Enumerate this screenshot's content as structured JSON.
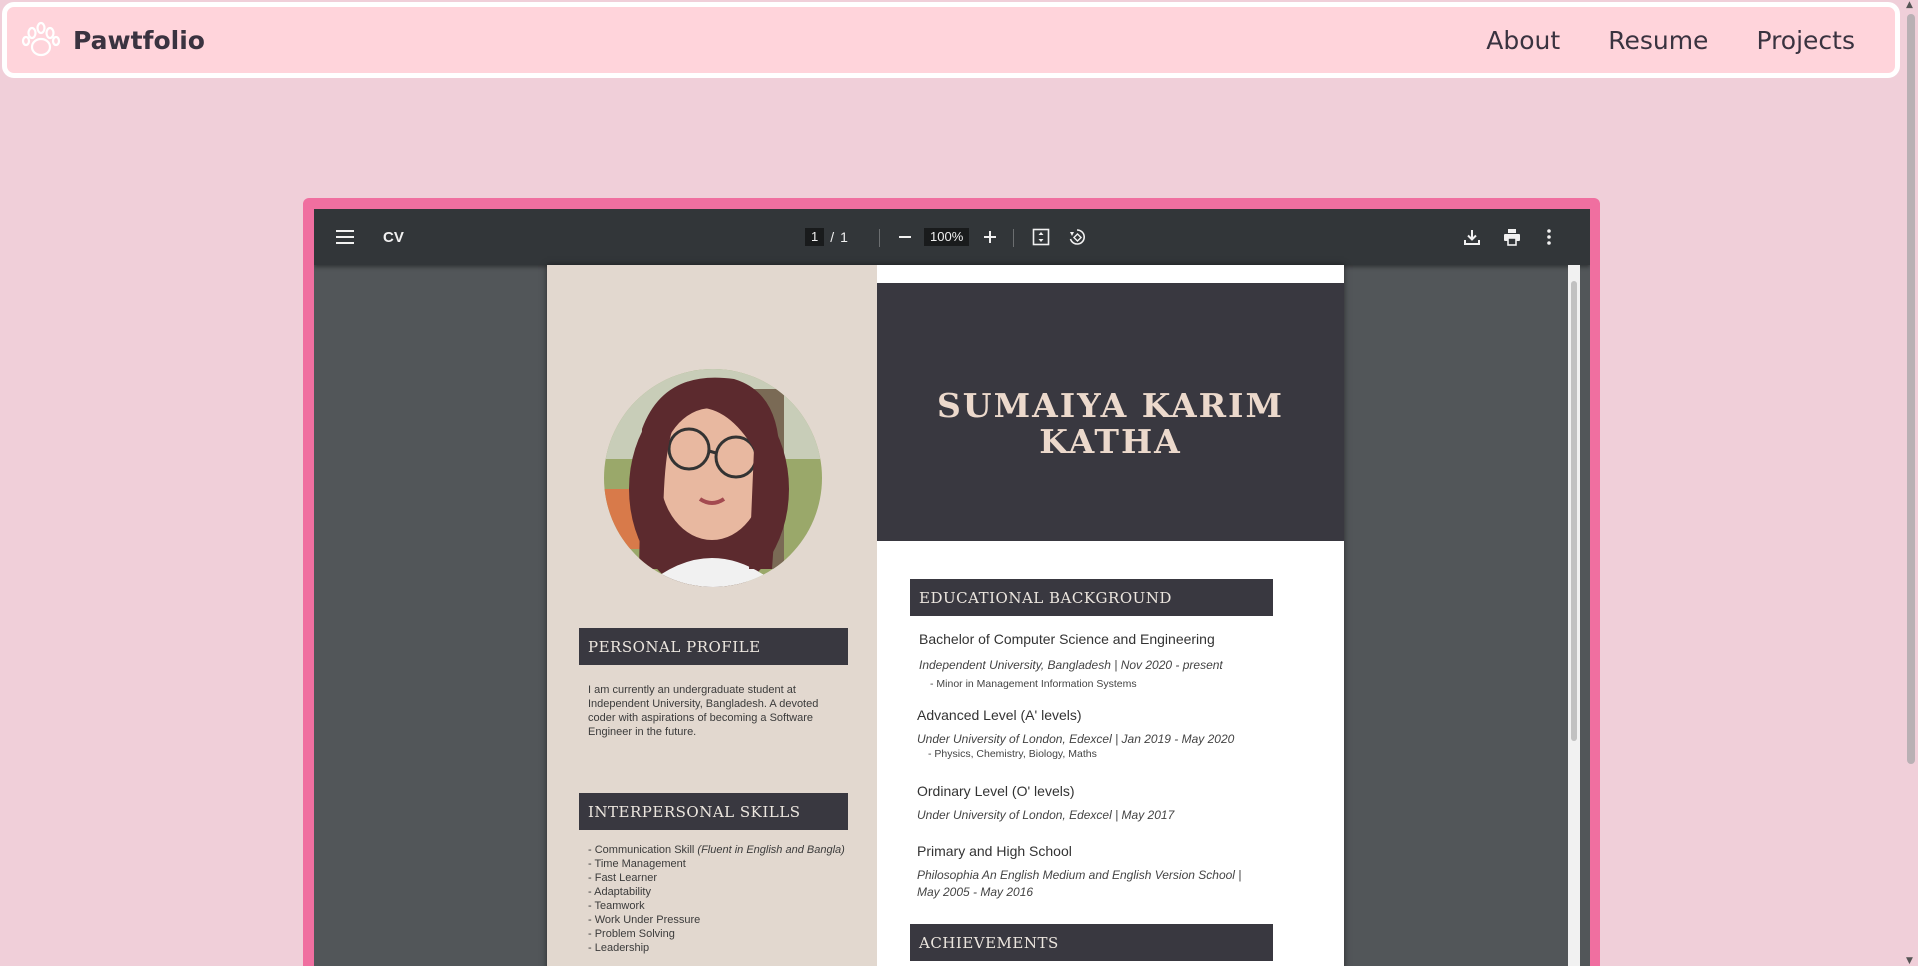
{
  "nav": {
    "brand": "Pawtfolio",
    "links": [
      "About",
      "Resume",
      "Projects"
    ]
  },
  "viewer": {
    "title": "CV",
    "page_current": "1",
    "page_separator": "/",
    "page_total": "1",
    "zoom": "100%"
  },
  "cv": {
    "name_line1": "SUMAIYA KARIM",
    "name_line2": "KATHA",
    "personal_profile": {
      "heading": "PERSONAL PROFILE",
      "text": "I am currently an undergraduate student at Independent University, Bangladesh. A devoted coder with aspirations of becoming a Software Engineer in the future."
    },
    "interpersonal_skills": {
      "heading": "INTERPERSONAL SKILLS",
      "items": [
        {
          "text": "- Communication Skill ",
          "note": "(Fluent in English and Bangla)"
        },
        {
          "text": "- Time Management",
          "note": ""
        },
        {
          "text": "- Fast Learner",
          "note": ""
        },
        {
          "text": "- Adaptability",
          "note": ""
        },
        {
          "text": "- Teamwork",
          "note": ""
        },
        {
          "text": "- Work Under Pressure",
          "note": ""
        },
        {
          "text": "- Problem Solving",
          "note": ""
        },
        {
          "text": "- Leadership",
          "note": ""
        }
      ]
    },
    "education": {
      "heading": "EDUCATIONAL BACKGROUND",
      "entries": [
        {
          "title": "Bachelor of Computer Science and Engineering",
          "sub": "Independent University, Bangladesh | Nov 2020 - present",
          "note": "- Minor in  Management Information Systems"
        },
        {
          "title": "Advanced Level (A' levels)",
          "sub": "Under University of London, Edexcel | Jan 2019 - May 2020",
          "note": "- Physics, Chemistry, Biology, Maths"
        },
        {
          "title": "Ordinary Level (O' levels)",
          "sub": "Under University of London, Edexcel | May 2017",
          "note": ""
        },
        {
          "title": "Primary and High School",
          "sub": "Philosophia An English Medium and English Version School | May 2005 - May 2016",
          "note": ""
        }
      ]
    },
    "achievements": {
      "heading": "ACHIEVEMENTS"
    }
  }
}
